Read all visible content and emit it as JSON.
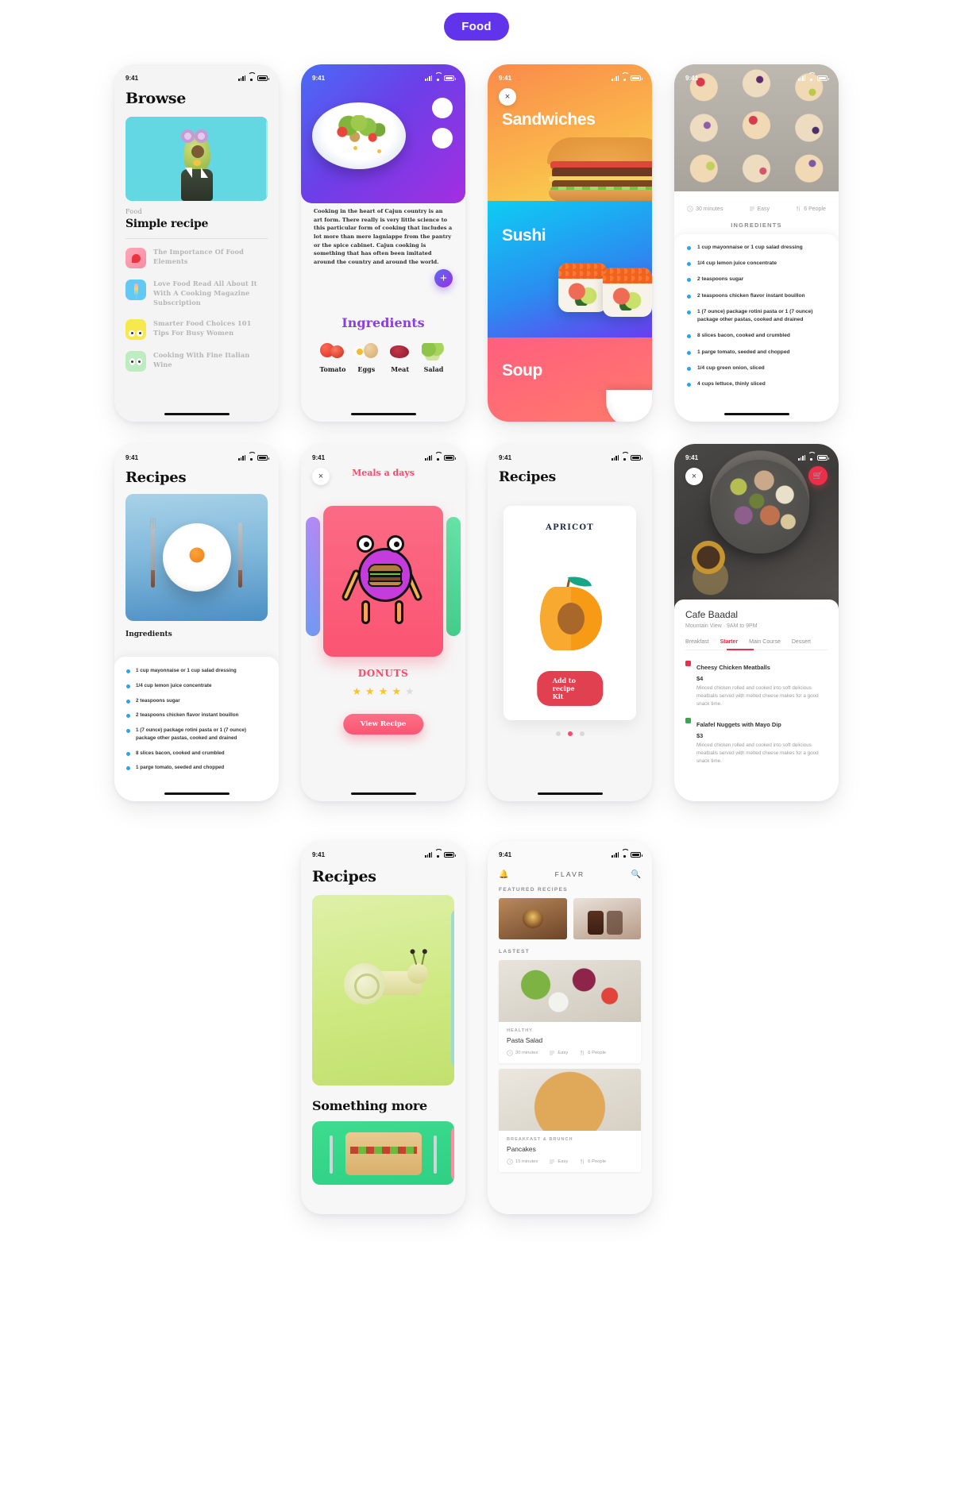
{
  "header": {
    "pill_label": "Food",
    "accent": "#6134eb"
  },
  "status": {
    "time": "9:41"
  },
  "p1": {
    "title": "Browse",
    "kicker": "Food",
    "subtitle": "Simple recipe",
    "articles": [
      {
        "title": "The Importance Of Food Elements",
        "icon": "rose-icon"
      },
      {
        "title": "Love Food Read All About It With A Cooking Magazine Subscription",
        "icon": "popsicle-icon"
      },
      {
        "title": "Smarter Food Choices 101 Tips For Busy Women",
        "icon": "yellow-face-icon"
      },
      {
        "title": "Cooking With Fine Italian Wine",
        "icon": "green-face-icon"
      }
    ]
  },
  "p2": {
    "paragraph": "Cooking in the heart of Cajun country is an art form. There really is very little science to this particular form of cooking that includes a lot more than mere lagniappe from the pantry or the spice cabinet. Cajun cooking is something that has often been imitated around the country and around the world.",
    "fab": "+",
    "ingredients_title": "Ingredients",
    "ingredients": [
      {
        "label": "Tomato"
      },
      {
        "label": "Eggs"
      },
      {
        "label": "Meat"
      },
      {
        "label": "Salad"
      }
    ]
  },
  "p3": {
    "close": "×",
    "categories": [
      {
        "label": "Sandwiches",
        "color": "#f9a24b"
      },
      {
        "label": "Sushi",
        "color": "#2a8df0"
      },
      {
        "label": "Soup",
        "color": "#ff5f7e"
      }
    ]
  },
  "p4": {
    "meta": [
      {
        "icon": "clock-icon",
        "text": "30 minutes"
      },
      {
        "icon": "level-icon",
        "text": "Easy"
      },
      {
        "icon": "people-icon",
        "text": "6 People"
      }
    ],
    "section_title": "INGREDIENTS",
    "ingredients": [
      "1 cup mayonnaise or 1 cup salad dressing",
      "1/4 cup lemon juice concentrate",
      "2 teaspoons sugar",
      "2 teaspoons chicken flavor instant bouillon",
      "1 (7 ounce) package rotini pasta or 1 (7 ounce) package other pastas, cooked and drained",
      "8 slices bacon, cooked and crumbled",
      "1 parge tomato, seeded and chopped",
      "1/4 cup green onion, sliced",
      "4 cups lettuce, thinly sliced"
    ]
  },
  "p5": {
    "title": "Recipes",
    "section_title": "Ingredients",
    "ingredients": [
      "1 cup mayonnaise or 1 cup salad dressing",
      "1/4 cup lemon juice concentrate",
      "2 teaspoons sugar",
      "2 teaspoons chicken flavor instant bouillon",
      "1 (7 ounce) package rotini pasta or 1 (7 ounce) package other pastas, cooked and drained",
      "8 slices bacon, cooked and crumbled",
      "1 parge tomato, seeded and chopped"
    ]
  },
  "p6": {
    "close": "×",
    "title": "Meals a days",
    "item_name": "DONUTS",
    "rating": 4,
    "stars_total": 5,
    "cta": "View Recipe"
  },
  "p7": {
    "title": "Recipes",
    "card_title": "APRICOT",
    "cta": "Add to recipe Kit",
    "dots": 3,
    "active_dot": 2
  },
  "p8": {
    "close": "×",
    "cart_icon": "cart-icon",
    "name": "Cafe Baadal",
    "subtitle": "Mountain View  ·  9AM to 9PM",
    "tabs": [
      "Breakfast",
      "Starter",
      "Main Course",
      "Dessert"
    ],
    "active_tab": "Starter",
    "dishes": [
      {
        "name": "Cheesy Chicken Meatballs",
        "price": "$4",
        "desc": "Minced chicken rolled and cooked into soft delicious meatballs served with melted cheese makes for a good snack time.",
        "type": "non-veg"
      },
      {
        "name": "Falafel Nuggets with Mayo Dip",
        "price": "$3",
        "desc": "Minced chicken rolled and cooked into soft delicious meatballs served with melted cheese makes for a good snack time.",
        "type": "veg"
      }
    ]
  },
  "p9": {
    "title": "Recipes",
    "more_title": "Something more"
  },
  "p10": {
    "logo": "FLAVR",
    "bell_icon": "bell-icon",
    "search_icon": "search-icon",
    "sections": [
      {
        "label": "FEATURED RECIPES"
      },
      {
        "label": "LASTEST"
      }
    ],
    "latest": [
      {
        "kicker": "HEALTHY",
        "name": "Pasta Salad",
        "meta": [
          {
            "icon": "clock-icon",
            "text": "30 minutes"
          },
          {
            "icon": "level-icon",
            "text": "Easy"
          },
          {
            "icon": "people-icon",
            "text": "6 People"
          }
        ]
      },
      {
        "kicker": "BREAKFAST & BRUNCH",
        "name": "Pancakes",
        "meta": [
          {
            "icon": "clock-icon",
            "text": "15 minutes"
          },
          {
            "icon": "level-icon",
            "text": "Easy"
          },
          {
            "icon": "people-icon",
            "text": "6 People"
          }
        ]
      }
    ]
  }
}
